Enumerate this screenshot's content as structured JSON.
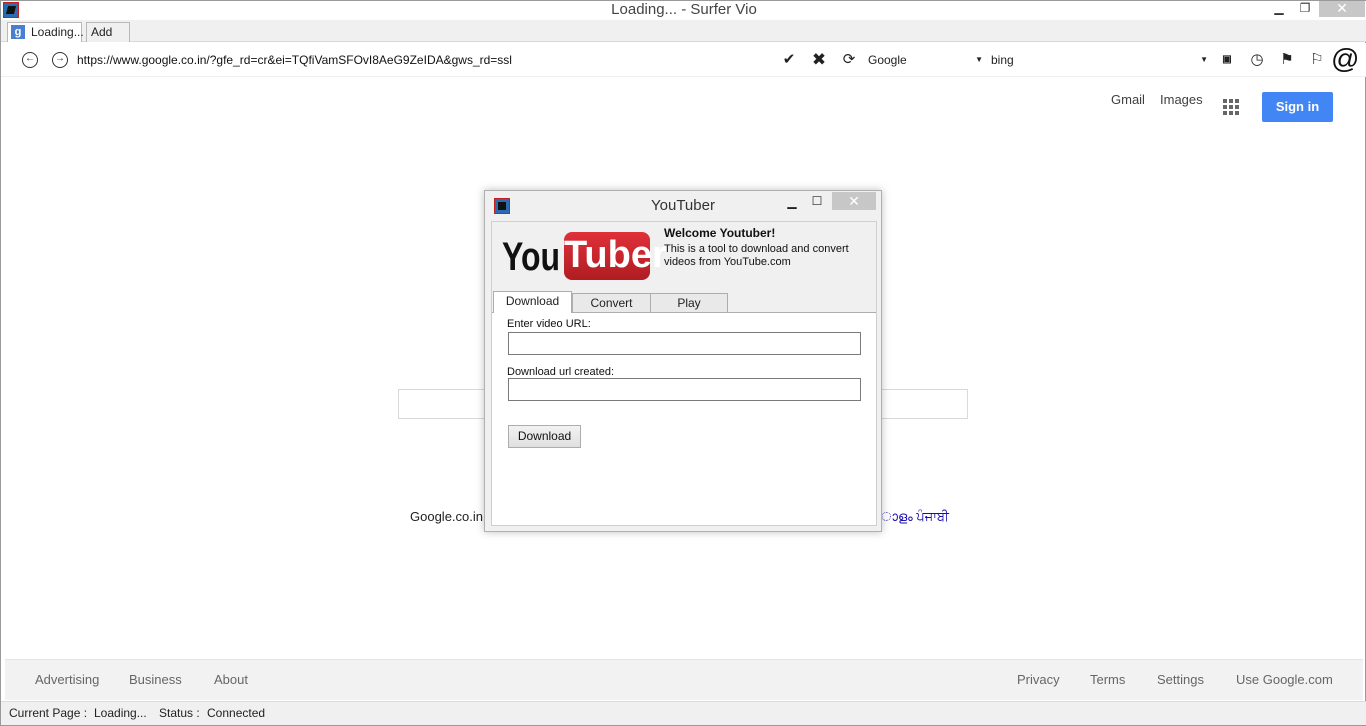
{
  "window": {
    "title": "Loading... - Surfer Vio"
  },
  "tabs": [
    {
      "label": "Loading..."
    },
    {
      "label": "Add tab"
    }
  ],
  "address": {
    "url": "https://www.google.co.in/?gfe_rd=cr&ei=TQfiVamSFOvI8AeG9ZeIDA&gws_rd=ssl"
  },
  "search": {
    "engine": "Google",
    "query": "bing"
  },
  "google": {
    "top_links": [
      "Gmail",
      "Images"
    ],
    "signin_label": "Sign in",
    "offered_in": "Google.co.in",
    "langs": "ാളം ਪੰਜਾਬੀ",
    "footer_left": [
      "Advertising",
      "Business",
      "About"
    ],
    "footer_right": [
      "Privacy",
      "Terms",
      "Settings",
      "Use Google.com"
    ],
    "accent": "#4285f4"
  },
  "status": {
    "page_label": "Current Page :",
    "page_value": "Loading...",
    "status_label": "Status :",
    "status_value": "Connected"
  },
  "dialog": {
    "title": "YouTuber",
    "logo_you": "You",
    "logo_tube": "Tuber",
    "welcome": "Welcome Youtuber!",
    "description": "This is a tool to download and convert videos from YouTube.com",
    "tabs": [
      "Download",
      "Convert",
      "Play"
    ],
    "url_label": "Enter video URL:",
    "created_label": "Download url created:",
    "download_button": "Download"
  }
}
